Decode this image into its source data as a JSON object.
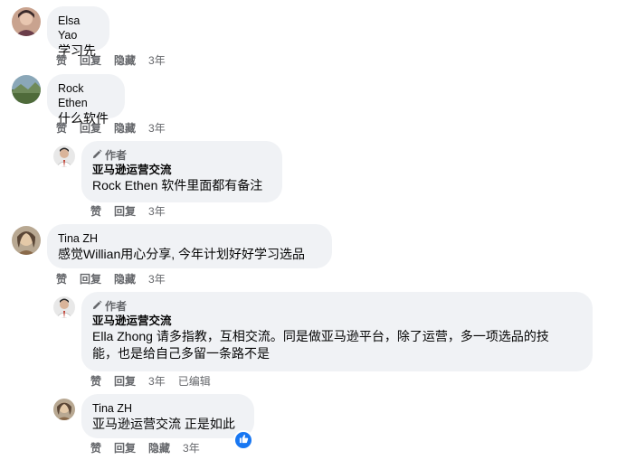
{
  "labels": {
    "like": "赞",
    "reply": "回复",
    "hide": "隐藏",
    "author": "作者",
    "edited": "已编辑"
  },
  "comments": [
    {
      "name": "Elsa Yao",
      "text": "学习先",
      "time": "3年"
    },
    {
      "name": "Rock Ethen",
      "text": "什么软件",
      "time": "3年"
    },
    {
      "name": "亚马逊运营交流",
      "text": "Rock Ethen 软件里面都有备注",
      "time": "3年"
    },
    {
      "name": "Tina ZH",
      "text": "感觉Willian用心分享, 今年计划好好学习选品",
      "time": "3年"
    },
    {
      "name": "亚马逊运营交流",
      "text_line1": "Ella Zhong 请多指教，互相交流。同是做亚马逊平台，除了运营，多一项选品的技",
      "text_line2": "能，也是给自己多留一条路不是",
      "time": "3年"
    },
    {
      "name": "Tina ZH",
      "text": "亚马逊运营交流 正是如此",
      "time": "3年"
    }
  ],
  "colors": {
    "bubble": "#f0f2f5",
    "meta": "#65676b",
    "text": "#050505",
    "like_blue": "#1877f2"
  },
  "icons": [
    "pencil-icon",
    "thumbs-up-icon"
  ]
}
